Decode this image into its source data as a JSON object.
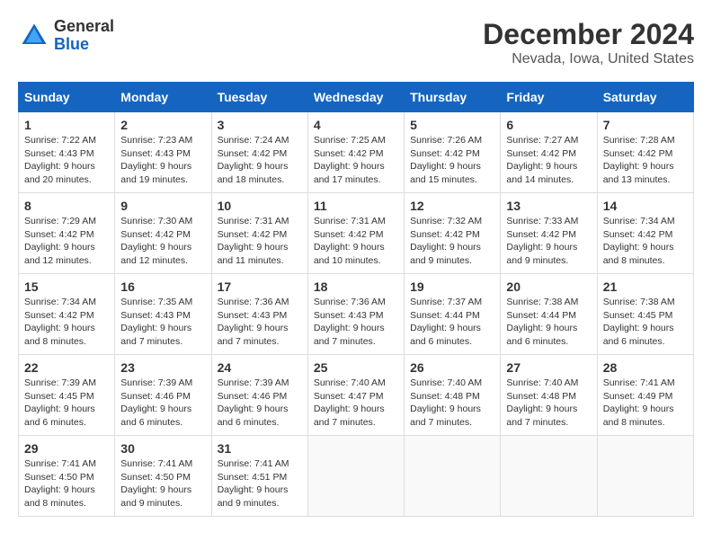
{
  "header": {
    "logo_general": "General",
    "logo_blue": "Blue",
    "title": "December 2024",
    "subtitle": "Nevada, Iowa, United States"
  },
  "weekdays": [
    "Sunday",
    "Monday",
    "Tuesday",
    "Wednesday",
    "Thursday",
    "Friday",
    "Saturday"
  ],
  "weeks": [
    [
      {
        "day": "1",
        "sunrise": "7:22 AM",
        "sunset": "4:43 PM",
        "daylight": "9 hours and 20 minutes."
      },
      {
        "day": "2",
        "sunrise": "7:23 AM",
        "sunset": "4:43 PM",
        "daylight": "9 hours and 19 minutes."
      },
      {
        "day": "3",
        "sunrise": "7:24 AM",
        "sunset": "4:42 PM",
        "daylight": "9 hours and 18 minutes."
      },
      {
        "day": "4",
        "sunrise": "7:25 AM",
        "sunset": "4:42 PM",
        "daylight": "9 hours and 17 minutes."
      },
      {
        "day": "5",
        "sunrise": "7:26 AM",
        "sunset": "4:42 PM",
        "daylight": "9 hours and 15 minutes."
      },
      {
        "day": "6",
        "sunrise": "7:27 AM",
        "sunset": "4:42 PM",
        "daylight": "9 hours and 14 minutes."
      },
      {
        "day": "7",
        "sunrise": "7:28 AM",
        "sunset": "4:42 PM",
        "daylight": "9 hours and 13 minutes."
      }
    ],
    [
      {
        "day": "8",
        "sunrise": "7:29 AM",
        "sunset": "4:42 PM",
        "daylight": "9 hours and 12 minutes."
      },
      {
        "day": "9",
        "sunrise": "7:30 AM",
        "sunset": "4:42 PM",
        "daylight": "9 hours and 12 minutes."
      },
      {
        "day": "10",
        "sunrise": "7:31 AM",
        "sunset": "4:42 PM",
        "daylight": "9 hours and 11 minutes."
      },
      {
        "day": "11",
        "sunrise": "7:31 AM",
        "sunset": "4:42 PM",
        "daylight": "9 hours and 10 minutes."
      },
      {
        "day": "12",
        "sunrise": "7:32 AM",
        "sunset": "4:42 PM",
        "daylight": "9 hours and 9 minutes."
      },
      {
        "day": "13",
        "sunrise": "7:33 AM",
        "sunset": "4:42 PM",
        "daylight": "9 hours and 9 minutes."
      },
      {
        "day": "14",
        "sunrise": "7:34 AM",
        "sunset": "4:42 PM",
        "daylight": "9 hours and 8 minutes."
      }
    ],
    [
      {
        "day": "15",
        "sunrise": "7:34 AM",
        "sunset": "4:42 PM",
        "daylight": "9 hours and 8 minutes."
      },
      {
        "day": "16",
        "sunrise": "7:35 AM",
        "sunset": "4:43 PM",
        "daylight": "9 hours and 7 minutes."
      },
      {
        "day": "17",
        "sunrise": "7:36 AM",
        "sunset": "4:43 PM",
        "daylight": "9 hours and 7 minutes."
      },
      {
        "day": "18",
        "sunrise": "7:36 AM",
        "sunset": "4:43 PM",
        "daylight": "9 hours and 7 minutes."
      },
      {
        "day": "19",
        "sunrise": "7:37 AM",
        "sunset": "4:44 PM",
        "daylight": "9 hours and 6 minutes."
      },
      {
        "day": "20",
        "sunrise": "7:38 AM",
        "sunset": "4:44 PM",
        "daylight": "9 hours and 6 minutes."
      },
      {
        "day": "21",
        "sunrise": "7:38 AM",
        "sunset": "4:45 PM",
        "daylight": "9 hours and 6 minutes."
      }
    ],
    [
      {
        "day": "22",
        "sunrise": "7:39 AM",
        "sunset": "4:45 PM",
        "daylight": "9 hours and 6 minutes."
      },
      {
        "day": "23",
        "sunrise": "7:39 AM",
        "sunset": "4:46 PM",
        "daylight": "9 hours and 6 minutes."
      },
      {
        "day": "24",
        "sunrise": "7:39 AM",
        "sunset": "4:46 PM",
        "daylight": "9 hours and 6 minutes."
      },
      {
        "day": "25",
        "sunrise": "7:40 AM",
        "sunset": "4:47 PM",
        "daylight": "9 hours and 7 minutes."
      },
      {
        "day": "26",
        "sunrise": "7:40 AM",
        "sunset": "4:48 PM",
        "daylight": "9 hours and 7 minutes."
      },
      {
        "day": "27",
        "sunrise": "7:40 AM",
        "sunset": "4:48 PM",
        "daylight": "9 hours and 7 minutes."
      },
      {
        "day": "28",
        "sunrise": "7:41 AM",
        "sunset": "4:49 PM",
        "daylight": "9 hours and 8 minutes."
      }
    ],
    [
      {
        "day": "29",
        "sunrise": "7:41 AM",
        "sunset": "4:50 PM",
        "daylight": "9 hours and 8 minutes."
      },
      {
        "day": "30",
        "sunrise": "7:41 AM",
        "sunset": "4:50 PM",
        "daylight": "9 hours and 9 minutes."
      },
      {
        "day": "31",
        "sunrise": "7:41 AM",
        "sunset": "4:51 PM",
        "daylight": "9 hours and 9 minutes."
      },
      null,
      null,
      null,
      null
    ]
  ]
}
